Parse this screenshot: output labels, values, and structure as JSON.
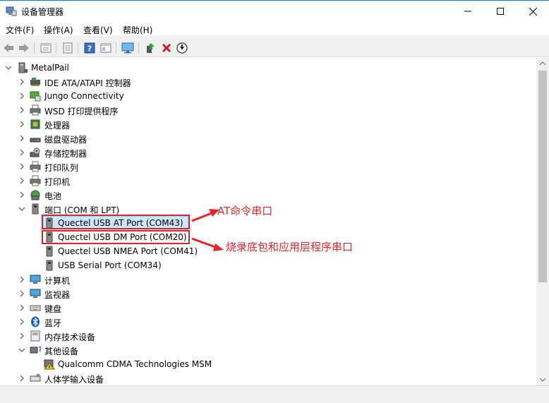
{
  "window": {
    "title": "设备管理器"
  },
  "menu": {
    "file": "文件(F)",
    "action": "操作(A)",
    "view": "查看(V)",
    "help": "帮助(H)"
  },
  "tree": {
    "root": "MetalPail",
    "categories": {
      "ide": "IDE ATA/ATAPI 控制器",
      "jungo": "Jungo Connectivity",
      "wsd": "WSD 打印提供程序",
      "cpu": "处理器",
      "disk": "磁盘驱动器",
      "storage": "存储控制器",
      "printqueue": "打印队列",
      "printer": "打印机",
      "battery": "电池",
      "ports": "端口 (COM 和 LPT)",
      "computer": "计算机",
      "monitor": "监视器",
      "keyboard": "键盘",
      "bluetooth": "蓝牙",
      "memtech": "内存技术设备",
      "other": "其他设备",
      "hid": "人体学输入设备"
    },
    "ports_children": [
      "Quectel USB AT Port (COM43)",
      "Quectel USB DM Port (COM20)",
      "Quectel USB NMEA Port (COM41)",
      "USB Serial Port (COM34)"
    ],
    "other_children": [
      "Qualcomm CDMA Technologies MSM"
    ]
  },
  "annotations": {
    "at": "AT命令串口",
    "dm": "烧录底包和应用层程序串口"
  },
  "colors": {
    "annotation": "#e8242a",
    "selection": "#cce8ff",
    "accent": "#1e7ad9"
  }
}
